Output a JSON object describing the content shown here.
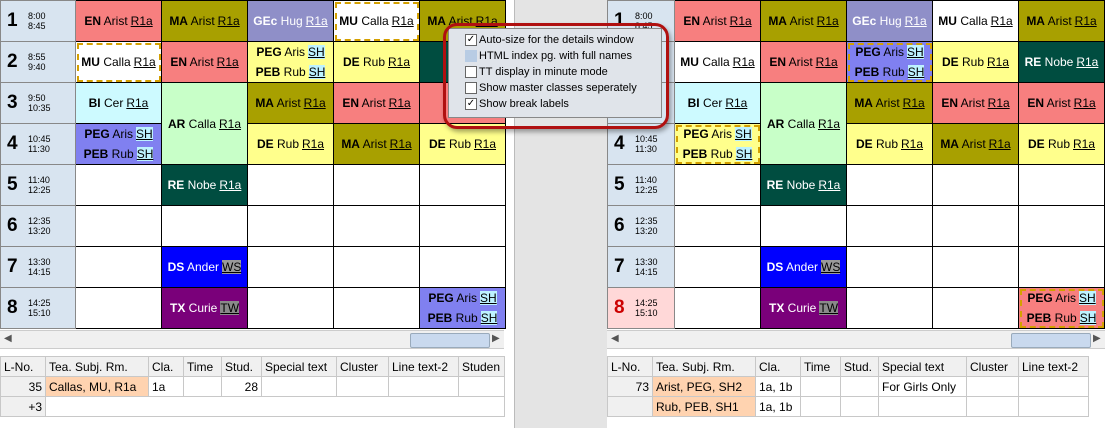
{
  "periods": [
    {
      "num": "1",
      "start": "8:00",
      "end": "8:45"
    },
    {
      "num": "2",
      "start": "8:55",
      "end": "9:40"
    },
    {
      "num": "3",
      "start": "9:50",
      "end": "10:35"
    },
    {
      "num": "4",
      "start": "10:45",
      "end": "11:30"
    },
    {
      "num": "5",
      "start": "11:40",
      "end": "12:25"
    },
    {
      "num": "6",
      "start": "12:35",
      "end": "13:20"
    },
    {
      "num": "7",
      "start": "13:30",
      "end": "14:15"
    },
    {
      "num": "8",
      "start": "14:25",
      "end": "15:10"
    }
  ],
  "lessons": {
    "en_arist": {
      "subj": "EN",
      "teacher": "Arist",
      "room": "R1a"
    },
    "ma_arist": {
      "subj": "MA",
      "teacher": "Arist",
      "room": "R1a"
    },
    "gec_hug": {
      "subj": "GEc",
      "teacher": "Hug",
      "room": "R1a"
    },
    "mu_calla": {
      "subj": "MU",
      "teacher": "Calla",
      "room": "R1a"
    },
    "peg_aris": {
      "subj": "PEG",
      "teacher": "Aris",
      "room": "SH"
    },
    "peb_rub": {
      "subj": "PEB",
      "teacher": "Rub",
      "room": "SH"
    },
    "de_rub": {
      "subj": "DE",
      "teacher": "Rub",
      "room": "R1a"
    },
    "re_nobe": {
      "subj": "RE",
      "teacher": "Nobe",
      "room": "R1a"
    },
    "bi_cer": {
      "subj": "BI",
      "teacher": "Cer",
      "room": "R1a"
    },
    "ar_calla": {
      "subj": "AR",
      "teacher": "Calla",
      "room": "R1a"
    },
    "ds_ander": {
      "subj": "DS",
      "teacher": "Ander",
      "room": "WS"
    },
    "tx_curie": {
      "subj": "TX",
      "teacher": "Curie",
      "room": "TW"
    },
    "en_truncated": {
      "subj": "EN"
    }
  },
  "popup": {
    "options": [
      {
        "label": "Auto-size for the details window",
        "checked": "✓"
      },
      {
        "label": "HTML index pg. with full names",
        "checked": ""
      },
      {
        "label": "TT display in minute mode",
        "checked": ""
      },
      {
        "label": "Show master classes seperately",
        "checked": ""
      },
      {
        "label": "Show break labels",
        "checked": "✓"
      }
    ]
  },
  "left_grid": {
    "headers": [
      "L-No.",
      "Tea. Subj. Rm.",
      "Cla.",
      "Time",
      "Stud.",
      "Special text",
      "Cluster",
      "Line text-2",
      "Studen"
    ],
    "rows": [
      [
        "35",
        "Callas, MU, R1a",
        "1a",
        "",
        "28",
        "",
        "",
        "",
        ""
      ],
      [
        "+3",
        "",
        "",
        "",
        "",
        "",
        "",
        "",
        ""
      ]
    ]
  },
  "right_grid": {
    "headers": [
      "L-No.",
      "Tea. Subj. Rm.",
      "Cla.",
      "Time",
      "Stud.",
      "Special text",
      "Cluster",
      "Line text-2"
    ],
    "rows": [
      [
        "73",
        "Arist, PEG, SH2",
        "1a, 1b",
        "",
        "",
        "For Girls Only",
        "",
        ""
      ],
      [
        "",
        "Rub, PEB, SH1",
        "1a, 1b",
        "",
        "",
        "",
        "",
        ""
      ]
    ]
  },
  "scroll": {
    "left_arrow": "◀",
    "right_arrow": "▶"
  }
}
